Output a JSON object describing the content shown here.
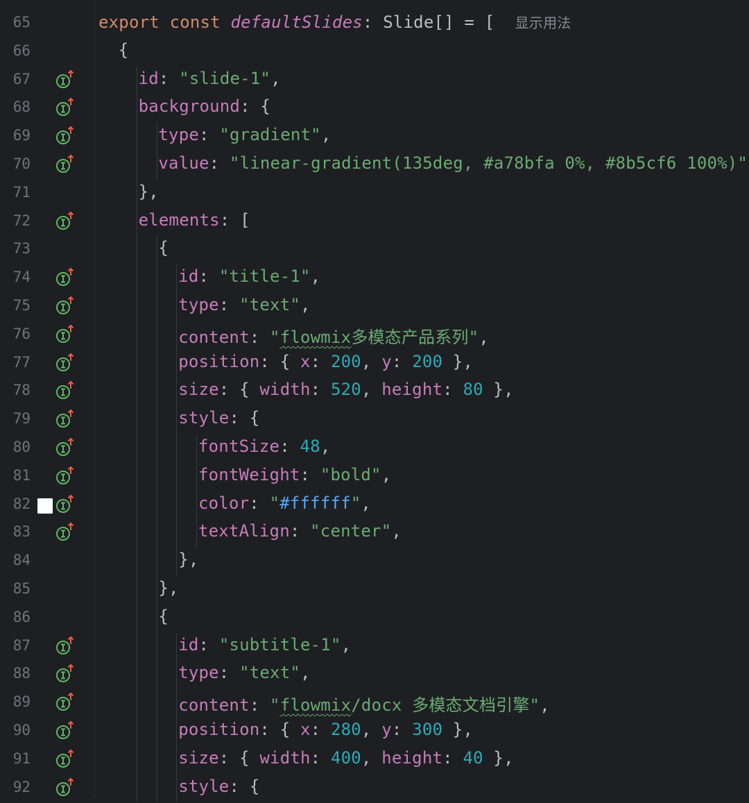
{
  "editor": {
    "colors": {
      "background": "#1e1f22",
      "keyword": "#cf8e6d",
      "property": "#c77dbb",
      "string": "#6aab73",
      "number": "#2aacb8",
      "hex_string": "#56a8f5",
      "line_number": "#6f737a"
    },
    "gutter_icon": "implementation-up-arrow-icon",
    "lines": [
      {
        "no": "65",
        "indent": 0,
        "icon": false,
        "tokens": [
          {
            "t": "export",
            "c": "kw"
          },
          {
            "t": " ",
            "c": "pl"
          },
          {
            "t": "const",
            "c": "kw"
          },
          {
            "t": " ",
            "c": "pl"
          },
          {
            "t": "defaultSlides",
            "c": "fn"
          },
          {
            "t": ": Slide[] = [  ",
            "c": "pl"
          },
          {
            "t": "显示用法",
            "c": "hint"
          }
        ]
      },
      {
        "no": "66",
        "indent": 1,
        "icon": false,
        "tokens": [
          {
            "t": "{",
            "c": "pl"
          }
        ]
      },
      {
        "no": "67",
        "indent": 2,
        "icon": true,
        "tokens": [
          {
            "t": "id",
            "c": "prop"
          },
          {
            "t": ": ",
            "c": "pl"
          },
          {
            "t": "\"slide-1\"",
            "c": "str"
          },
          {
            "t": ",",
            "c": "pl"
          }
        ]
      },
      {
        "no": "68",
        "indent": 2,
        "icon": true,
        "tokens": [
          {
            "t": "background",
            "c": "prop"
          },
          {
            "t": ": {",
            "c": "pl"
          }
        ]
      },
      {
        "no": "69",
        "indent": 3,
        "icon": true,
        "tokens": [
          {
            "t": "type",
            "c": "prop"
          },
          {
            "t": ": ",
            "c": "pl"
          },
          {
            "t": "\"gradient\"",
            "c": "str"
          },
          {
            "t": ",",
            "c": "pl"
          }
        ]
      },
      {
        "no": "70",
        "indent": 3,
        "icon": true,
        "tokens": [
          {
            "t": "value",
            "c": "prop"
          },
          {
            "t": ": ",
            "c": "pl"
          },
          {
            "t": "\"linear-gradient(135deg, #a78bfa 0%, #8b5cf6 100%)\"",
            "c": "str"
          },
          {
            "t": ",",
            "c": "pl"
          }
        ]
      },
      {
        "no": "71",
        "indent": 2,
        "icon": false,
        "tokens": [
          {
            "t": "},",
            "c": "pl"
          }
        ]
      },
      {
        "no": "72",
        "indent": 2,
        "icon": true,
        "tokens": [
          {
            "t": "elements",
            "c": "prop"
          },
          {
            "t": ": [",
            "c": "pl"
          }
        ]
      },
      {
        "no": "73",
        "indent": 3,
        "icon": false,
        "tokens": [
          {
            "t": "{",
            "c": "pl"
          }
        ]
      },
      {
        "no": "74",
        "indent": 4,
        "icon": true,
        "tokens": [
          {
            "t": "id",
            "c": "prop"
          },
          {
            "t": ": ",
            "c": "pl"
          },
          {
            "t": "\"title-1\"",
            "c": "str"
          },
          {
            "t": ",",
            "c": "pl"
          }
        ]
      },
      {
        "no": "75",
        "indent": 4,
        "icon": true,
        "tokens": [
          {
            "t": "type",
            "c": "prop"
          },
          {
            "t": ": ",
            "c": "pl"
          },
          {
            "t": "\"text\"",
            "c": "str"
          },
          {
            "t": ",",
            "c": "pl"
          }
        ]
      },
      {
        "no": "76",
        "indent": 4,
        "icon": true,
        "tokens": [
          {
            "t": "content",
            "c": "prop"
          },
          {
            "t": ": ",
            "c": "pl"
          },
          {
            "t": "\"",
            "c": "str"
          },
          {
            "t": "flowmix",
            "c": "str squig"
          },
          {
            "t": "多模态产品系列\"",
            "c": "str"
          },
          {
            "t": ",",
            "c": "pl"
          }
        ]
      },
      {
        "no": "77",
        "indent": 4,
        "icon": true,
        "tokens": [
          {
            "t": "position",
            "c": "prop"
          },
          {
            "t": ": { ",
            "c": "pl"
          },
          {
            "t": "x",
            "c": "prop"
          },
          {
            "t": ": ",
            "c": "pl"
          },
          {
            "t": "200",
            "c": "num"
          },
          {
            "t": ", ",
            "c": "pl"
          },
          {
            "t": "y",
            "c": "prop"
          },
          {
            "t": ": ",
            "c": "pl"
          },
          {
            "t": "200",
            "c": "num"
          },
          {
            "t": " },",
            "c": "pl"
          }
        ]
      },
      {
        "no": "78",
        "indent": 4,
        "icon": true,
        "tokens": [
          {
            "t": "size",
            "c": "prop"
          },
          {
            "t": ": { ",
            "c": "pl"
          },
          {
            "t": "width",
            "c": "prop"
          },
          {
            "t": ": ",
            "c": "pl"
          },
          {
            "t": "520",
            "c": "num"
          },
          {
            "t": ", ",
            "c": "pl"
          },
          {
            "t": "height",
            "c": "prop"
          },
          {
            "t": ": ",
            "c": "pl"
          },
          {
            "t": "80",
            "c": "num"
          },
          {
            "t": " },",
            "c": "pl"
          }
        ]
      },
      {
        "no": "79",
        "indent": 4,
        "icon": true,
        "tokens": [
          {
            "t": "style",
            "c": "prop"
          },
          {
            "t": ": {",
            "c": "pl"
          }
        ]
      },
      {
        "no": "80",
        "indent": 5,
        "icon": true,
        "tokens": [
          {
            "t": "fontSize",
            "c": "prop"
          },
          {
            "t": ": ",
            "c": "pl"
          },
          {
            "t": "48",
            "c": "num"
          },
          {
            "t": ",",
            "c": "pl"
          }
        ]
      },
      {
        "no": "81",
        "indent": 5,
        "icon": true,
        "tokens": [
          {
            "t": "fontWeight",
            "c": "prop"
          },
          {
            "t": ": ",
            "c": "pl"
          },
          {
            "t": "\"bold\"",
            "c": "str"
          },
          {
            "t": ",",
            "c": "pl"
          }
        ]
      },
      {
        "no": "82",
        "indent": 5,
        "icon": true,
        "marker": true,
        "tokens": [
          {
            "t": "color",
            "c": "prop"
          },
          {
            "t": ": ",
            "c": "pl"
          },
          {
            "t": "\"",
            "c": "str"
          },
          {
            "t": "#ffffff",
            "c": "hex"
          },
          {
            "t": "\"",
            "c": "str"
          },
          {
            "t": ",",
            "c": "pl"
          }
        ]
      },
      {
        "no": "83",
        "indent": 5,
        "icon": true,
        "tokens": [
          {
            "t": "textAlign",
            "c": "prop"
          },
          {
            "t": ": ",
            "c": "pl"
          },
          {
            "t": "\"center\"",
            "c": "str"
          },
          {
            "t": ",",
            "c": "pl"
          }
        ]
      },
      {
        "no": "84",
        "indent": 4,
        "icon": false,
        "tokens": [
          {
            "t": "},",
            "c": "pl"
          }
        ]
      },
      {
        "no": "85",
        "indent": 3,
        "icon": false,
        "tokens": [
          {
            "t": "},",
            "c": "pl"
          }
        ]
      },
      {
        "no": "86",
        "indent": 3,
        "icon": false,
        "tokens": [
          {
            "t": "{",
            "c": "pl"
          }
        ]
      },
      {
        "no": "87",
        "indent": 4,
        "icon": true,
        "tokens": [
          {
            "t": "id",
            "c": "prop"
          },
          {
            "t": ": ",
            "c": "pl"
          },
          {
            "t": "\"subtitle-1\"",
            "c": "str"
          },
          {
            "t": ",",
            "c": "pl"
          }
        ]
      },
      {
        "no": "88",
        "indent": 4,
        "icon": true,
        "tokens": [
          {
            "t": "type",
            "c": "prop"
          },
          {
            "t": ": ",
            "c": "pl"
          },
          {
            "t": "\"text\"",
            "c": "str"
          },
          {
            "t": ",",
            "c": "pl"
          }
        ]
      },
      {
        "no": "89",
        "indent": 4,
        "icon": true,
        "tokens": [
          {
            "t": "content",
            "c": "prop"
          },
          {
            "t": ": ",
            "c": "pl"
          },
          {
            "t": "\"",
            "c": "str"
          },
          {
            "t": "flowmix",
            "c": "str squig"
          },
          {
            "t": "/docx 多模态文档引擎\"",
            "c": "str"
          },
          {
            "t": ",",
            "c": "pl"
          }
        ]
      },
      {
        "no": "90",
        "indent": 4,
        "icon": true,
        "tokens": [
          {
            "t": "position",
            "c": "prop"
          },
          {
            "t": ": { ",
            "c": "pl"
          },
          {
            "t": "x",
            "c": "prop"
          },
          {
            "t": ": ",
            "c": "pl"
          },
          {
            "t": "280",
            "c": "num"
          },
          {
            "t": ", ",
            "c": "pl"
          },
          {
            "t": "y",
            "c": "prop"
          },
          {
            "t": ": ",
            "c": "pl"
          },
          {
            "t": "300",
            "c": "num"
          },
          {
            "t": " },",
            "c": "pl"
          }
        ]
      },
      {
        "no": "91",
        "indent": 4,
        "icon": true,
        "tokens": [
          {
            "t": "size",
            "c": "prop"
          },
          {
            "t": ": { ",
            "c": "pl"
          },
          {
            "t": "width",
            "c": "prop"
          },
          {
            "t": ": ",
            "c": "pl"
          },
          {
            "t": "400",
            "c": "num"
          },
          {
            "t": ", ",
            "c": "pl"
          },
          {
            "t": "height",
            "c": "prop"
          },
          {
            "t": ": ",
            "c": "pl"
          },
          {
            "t": "40",
            "c": "num"
          },
          {
            "t": " },",
            "c": "pl"
          }
        ]
      },
      {
        "no": "92",
        "indent": 4,
        "icon": true,
        "tokens": [
          {
            "t": "style",
            "c": "prop"
          },
          {
            "t": ": {",
            "c": "pl"
          }
        ]
      }
    ]
  }
}
